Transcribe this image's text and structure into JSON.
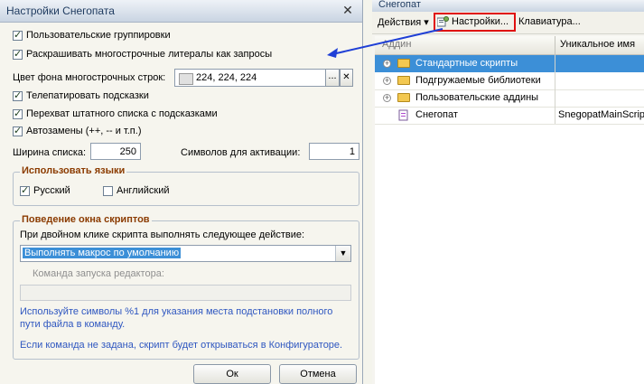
{
  "settings": {
    "title": "Настройки Снегопата",
    "options": {
      "user_groupings": "Пользовательские группировки",
      "expand_multiline": "Раскрашивать многострочные литералы как запросы",
      "telepathy": "Телепатировать подсказки",
      "intercept_list": "Перехват штатного списка с подсказками",
      "autoreplace": "Автозамены (++, -- и т.п.)"
    },
    "bg_color_label": "Цвет фона многострочных строк:",
    "bg_color_value": "224, 224, 224",
    "bg_color_hex": "#e0e0e0",
    "list_width_label": "Ширина списка:",
    "list_width_value": "250",
    "chars_label": "Символов для активации:",
    "chars_value": "1",
    "languages_group": "Использовать языки",
    "lang_ru": "Русский",
    "lang_en": "Английский",
    "behavior_group": "Поведение окна скриптов",
    "dblclick_label": "При двойном клике скрипта выполнять следующее действие:",
    "dblclick_value": "Выполнять макрос по умолчанию",
    "editor_cmd_label": "Команда запуска редактора:",
    "hint1": "Используйте символы %1 для указания места подстановки полного",
    "hint2": "пути файла в команду.",
    "hint3": "Если команда не задана, скрипт будет открываться в Конфигураторе.",
    "ok_label": "Ок",
    "cancel_label": "Отмена",
    "ellipsis": "...",
    "clear": "✕",
    "close": "✕"
  },
  "snegopat": {
    "title": "Снегопат",
    "toolbar": {
      "actions": "Действия ▾",
      "settings": "Настройки...",
      "keyboard": "Клавиатура..."
    },
    "columns": [
      "Аддин",
      "Уникальное имя"
    ],
    "rows": [
      {
        "name": "Стандартные скрипты",
        "unique": ""
      },
      {
        "name": "Подгружаемые библиотеки",
        "unique": ""
      },
      {
        "name": "Пользовательские аддины",
        "unique": ""
      },
      {
        "name": "Снегопат",
        "unique": "SnegopatMainScrip"
      }
    ]
  },
  "colors": {
    "selection": "#3c8fd7",
    "highlight_box": "#e01010",
    "arrow": "#1f3fd6"
  }
}
